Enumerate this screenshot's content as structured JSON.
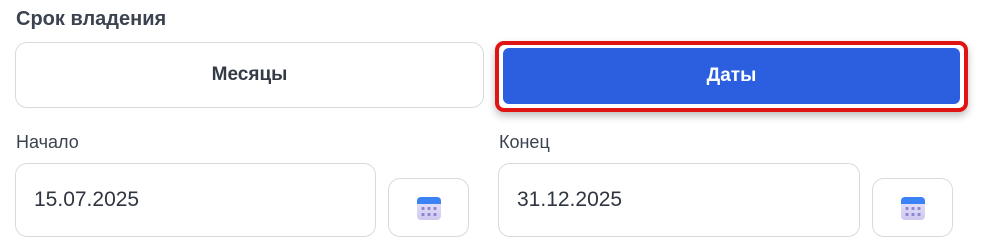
{
  "ownership": {
    "title": "Срок владения",
    "months_label": "Месяцы",
    "dates_label": "Даты",
    "selected": "Даты"
  },
  "start": {
    "label": "Начало",
    "value": "15.07.2025",
    "icon": "calendar-icon"
  },
  "end": {
    "label": "Конец",
    "value": "31.12.2025",
    "icon": "calendar-icon"
  },
  "colors": {
    "accent": "#2b5fe0",
    "highlight_border": "#e11414"
  }
}
